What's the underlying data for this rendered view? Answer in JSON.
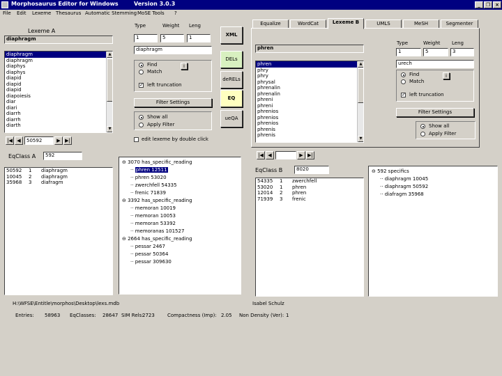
{
  "window": {
    "title": "Morphosaurus Editor for Windows        Version 3.0.3",
    "min": "_",
    "max": "❐",
    "close": "×"
  },
  "menu": [
    "File",
    "Edit",
    "Lexeme",
    "Thesaurus",
    "Automatic Stemming",
    "MoSE Tools",
    "?"
  ],
  "left": {
    "lexeme_label": "Lexeme A",
    "lexeme_value": "diaphragm",
    "type_label": "Type",
    "weight_label": "Weight",
    "leng_label": "Leng",
    "type_value": "1",
    "weight_value": "5",
    "leng_value": "1",
    "word_value": "diaphragm",
    "find_label": "Find",
    "match_label": "Match",
    "info_btn": "i",
    "left_trunc_label": "left truncation",
    "filter_settings": "Filter Settings",
    "show_all": "Show all",
    "apply_filter": "Apply Filter",
    "edit_dbl_click": "edit lexeme by double click",
    "lexeme_list": [
      "diaphragm",
      "diaphragm",
      "diaphys",
      "diaphys",
      "diapid",
      "diapid",
      "diapid",
      "diapoiesis",
      "diar",
      "diari",
      "diarrh",
      "diarrh",
      "diarth"
    ],
    "nav_value": "50592",
    "eqclass_label": "EqClass A",
    "eqclass_value": "592",
    "eq_rows": [
      {
        "id": "50592",
        "n": "1",
        "word": "diaphragm"
      },
      {
        "id": "10045",
        "n": "2",
        "word": "diaphragm"
      },
      {
        "id": "35968",
        "n": "3",
        "word": "diafragm"
      }
    ]
  },
  "buttons": {
    "xml": "XML",
    "dels": "DELs",
    "derels": "deRELs",
    "eq": "EQ",
    "ueqa": "ueQA"
  },
  "tree": [
    {
      "exp": "⊖",
      "indent": 0,
      "text": "3070 has_specific_reading",
      "sel": false
    },
    {
      "exp": "",
      "indent": 1,
      "text": "phren  12511",
      "sel": true
    },
    {
      "exp": "",
      "indent": 1,
      "text": "phren  53020",
      "sel": false
    },
    {
      "exp": "",
      "indent": 1,
      "text": "zwerchfell  54335",
      "sel": false
    },
    {
      "exp": "",
      "indent": 1,
      "text": "frenic  71839",
      "sel": false
    },
    {
      "exp": "⊖",
      "indent": 0,
      "text": "3392 has_specific_reading",
      "sel": false
    },
    {
      "exp": "",
      "indent": 1,
      "text": "memoran  10019",
      "sel": false
    },
    {
      "exp": "",
      "indent": 1,
      "text": "memoran  10053",
      "sel": false
    },
    {
      "exp": "",
      "indent": 1,
      "text": "memoran  53392",
      "sel": false
    },
    {
      "exp": "",
      "indent": 1,
      "text": "memoranas  101527",
      "sel": false
    },
    {
      "exp": "⊖",
      "indent": 0,
      "text": "2664 has_specific_reading",
      "sel": false
    },
    {
      "exp": "",
      "indent": 1,
      "text": "pessar  2467",
      "sel": false
    },
    {
      "exp": "",
      "indent": 1,
      "text": "pessar  50364",
      "sel": false
    },
    {
      "exp": "",
      "indent": 1,
      "text": "pessar  309630",
      "sel": false
    }
  ],
  "tabs": [
    "Equalize",
    "WordCat",
    "Lexeme B",
    "UMLS",
    "MeSH",
    "Segmenter"
  ],
  "right": {
    "lexeme_value": "phren",
    "type_label": "Type",
    "weight_label": "Weight",
    "leng_label": "Leng",
    "type_value": "1",
    "weight_value": "5",
    "leng_value": "3",
    "word_value": "urech",
    "find_label": "Find",
    "match_label": "Match",
    "info_btn": "i",
    "left_trunc_label": "left truncation",
    "filter_settings": "Filter Settings",
    "show_all": "Show all",
    "apply_filter": "Apply Filter",
    "lexeme_list": [
      "phren",
      "phry",
      "phry",
      "phrysal",
      "phrenalin",
      "phrenalin",
      "phreni",
      "phreni",
      "phrenios",
      "phrenios",
      "phrenios",
      "phrenis",
      "phrenis"
    ],
    "eqclass_label": "EqClass B",
    "eqclass_value": "8020",
    "eq_rows": [
      {
        "id": "54335",
        "n": "1",
        "word": "zwerchfell"
      },
      {
        "id": "53020",
        "n": "1",
        "word": "phren"
      },
      {
        "id": "12014",
        "n": "2",
        "word": "phren"
      },
      {
        "id": "71939",
        "n": "3",
        "word": "frenic"
      }
    ],
    "tree": [
      {
        "exp": "⊖",
        "indent": 0,
        "text": "592 specifics"
      },
      {
        "exp": "",
        "indent": 1,
        "text": "diaphragm  10045"
      },
      {
        "exp": "",
        "indent": 1,
        "text": "diaphragm  50592"
      },
      {
        "exp": "",
        "indent": 1,
        "text": "diafragm  35968"
      }
    ]
  },
  "status": {
    "path": "H:\\WFSE\\Entitle\\morphos\\Desktop\\lexs.mdb",
    "user": "Isabel Schulz",
    "entries_label": "Entries:",
    "entries_value": "58963",
    "eqclasses_label": "EqClasses:",
    "eqclasses_value": "28647",
    "simrels_label": "SIM Rels:",
    "simrels_value": "2723",
    "compactness_label": "Compactness (Imp):",
    "compactness_value": "2.05",
    "nondensity_label": "Non Density (Ver):",
    "nondensity_value": "1"
  }
}
